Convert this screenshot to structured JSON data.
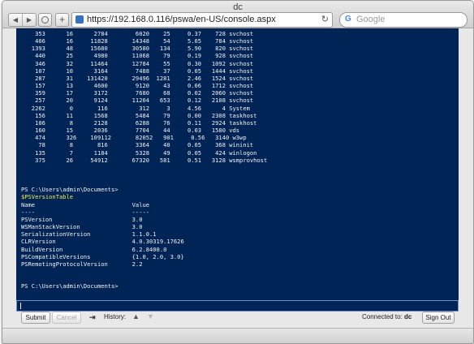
{
  "window": {
    "title": "dc"
  },
  "toolbar": {
    "back_icon": "back-arrow-icon",
    "forward_icon": "forward-arrow-icon",
    "add_tab_label": "+",
    "url": "https://192.168.0.116/pswa/en-US/console.aspx",
    "reload_symbol": "↻",
    "search_engine_glyph": "G",
    "search_placeholder": "Google"
  },
  "console": {
    "text": "    353      16      2784        6020    25     0.37    728 svchost\n    406      16     11828       14348    54     5.05    784 svchost\n   1393      48     15680       30580   134     5.90    820 svchost\n    440      25      4980       11068    79     0.19    928 svchost\n    346      32     11464       12784    55     0.30   1092 svchost\n    107      10      3164        7488    37     0.05   1444 svchost\n    287      31    131420       29496  1281     2.46   1524 svchost\n    157      13      4600        9120    43     0.06   1712 svchost\n    359      17      3172        7680    68     0.02   2060 svchost\n    257      20      9124       11204   653     0.12   2108 svchost\n   2262       0       116         312     3     4.56      4 System\n    156      11      1568        5484    79     0.00   2308 taskhost\n    106       8      2128        6288    76     0.11   2924 taskhost\n    160      15      2036        7704    44     0.03   1580 vds\n    474      326    109112       82052   901     0.56   3140 w3wp\n     78       8       816        3364    40     0.05    368 wininit\n    135       7      1184        5328    49     0.05    424 winlogon\n    375      26     54912       67320   581     0.51   3128 wsmprovhost\n\n\n\nPS C:\\Users\\admin\\Documents>",
    "command": "$PSVersionTable",
    "table": "\nName                            Value\n----                            -----\nPSVersion                       3.0\nWSManStackVersion               3.0\nSerializationVersion            1.1.0.1\nCLRVersion                      4.0.30319.17626\nBuildVersion                    6.2.8400.0\nPSCompatibleVersions            {1.0, 2.0, 3.0}\nPSRemotingProtocolVersion       2.2\n\n\nPS C:\\Users\\admin\\Documents>"
  },
  "controls": {
    "submit_label": "Submit",
    "cancel_label": "Cancel",
    "tab_icon": "⇥",
    "history_label": "History:",
    "history_up_icon": "▲",
    "history_down_icon": "▼",
    "connected_label": "Connected to:",
    "connected_host": "dc",
    "signout_label": "Sign Out"
  }
}
